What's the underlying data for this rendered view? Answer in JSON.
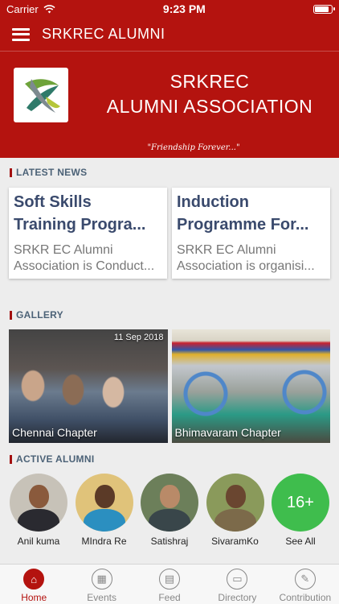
{
  "status_bar": {
    "carrier": "Carrier",
    "time": "9:23 PM",
    "battery_level": 0.9
  },
  "navbar": {
    "title": "SRKREC ALUMNI"
  },
  "hero": {
    "name_line1": "SRKREC",
    "name_line2": "ALUMNI ASSOCIATION",
    "motto": "\"Friendship Forever...\""
  },
  "sections": {
    "news": "LATEST NEWS",
    "gallery": "GALLERY",
    "alumni": "ACTIVE ALUMNI"
  },
  "news": [
    {
      "headline_line1": "Soft Skills",
      "headline_line2": "Training Progra...",
      "body_line1": "SRKR EC Alumni",
      "body_line2": "Association is Conduct..."
    },
    {
      "headline_line1": "Induction",
      "headline_line2": "Programme For...",
      "body_line1": "SRKR EC Alumni",
      "body_line2": "Association is organisi..."
    }
  ],
  "gallery": [
    {
      "label": "Chennai Chapter",
      "date": "11 Sep 2018"
    },
    {
      "label": "Bhimavaram Chapter",
      "date": ""
    }
  ],
  "alumni": [
    {
      "name": "Anil kuma",
      "bg": "#c7c2b8",
      "skin": "#8a5a3c",
      "shirt": "#2a2a30"
    },
    {
      "name": "MIndra Re",
      "bg": "#e0c37a",
      "skin": "#5b3a27",
      "shirt": "#2b8fc0"
    },
    {
      "name": "Satishraj",
      "bg": "#6c7f5a",
      "skin": "#b98a68",
      "shirt": "#39464a"
    },
    {
      "name": "SivaramKo",
      "bg": "#8a9a5b",
      "skin": "#6a4630",
      "shirt": "#7c6a4a"
    }
  ],
  "see_all": {
    "count": "16+",
    "label": "See All",
    "color": "#3fbd4d"
  },
  "tabs": [
    {
      "label": "Home",
      "icon": "home-icon",
      "glyph": "⌂"
    },
    {
      "label": "Events",
      "icon": "calendar-icon",
      "glyph": "▦"
    },
    {
      "label": "Feed",
      "icon": "feed-icon",
      "glyph": "▤"
    },
    {
      "label": "Directory",
      "icon": "folder-icon",
      "glyph": "▭"
    },
    {
      "label": "Contribution",
      "icon": "pencil-icon",
      "glyph": "✎"
    }
  ],
  "colors": {
    "brand": "#b4130f",
    "section_heading": "#4c6277"
  }
}
